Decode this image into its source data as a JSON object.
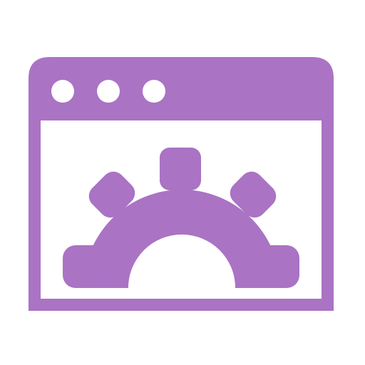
{
  "icon": {
    "name": "browser-window-settings-icon",
    "parts": [
      "window-frame",
      "title-bar",
      "window-dots",
      "gear-icon"
    ],
    "color": "#AA73C4",
    "background": "#FFFFFF"
  }
}
